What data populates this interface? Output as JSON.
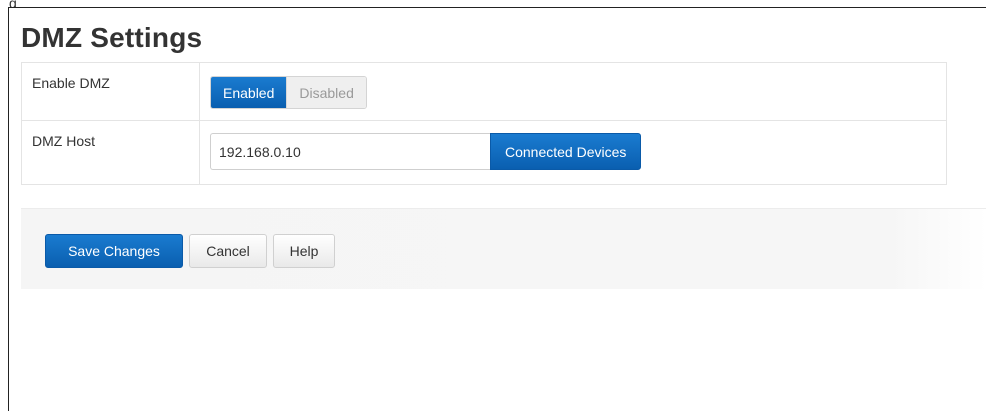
{
  "page": {
    "title": "DMZ Settings",
    "clipped_glyph": "g"
  },
  "settings": {
    "enable_dmz": {
      "label": "Enable DMZ",
      "enabled_label": "Enabled",
      "disabled_label": "Disabled",
      "selected": "Enabled"
    },
    "dmz_host": {
      "label": "DMZ Host",
      "value": "192.168.0.10",
      "devices_button_label": "Connected Devices"
    }
  },
  "actions": {
    "save_label": "Save Changes",
    "cancel_label": "Cancel",
    "help_label": "Help"
  },
  "colors": {
    "primary": "#0a6cc4",
    "text": "#333333",
    "muted": "#9a9a9a",
    "bar_bg": "#f5f5f5"
  }
}
